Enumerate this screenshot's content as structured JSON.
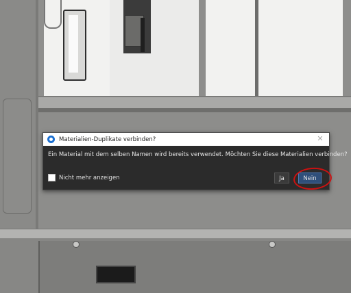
{
  "dialog": {
    "title": "Materialien-Duplikate verbinden?",
    "message": "Ein Material mit dem selben Namen wird bereits verwendet. Möchten Sie diese Materialien verbinden?",
    "checkbox_label": "Nicht mehr anzeigen",
    "checkbox_checked": false,
    "yes_label": "Ja",
    "no_label": "Nein",
    "close_icon": "close-icon",
    "app_icon": "app-logo-icon"
  },
  "colors": {
    "dialog_bg": "#2b2b2b",
    "titlebar_bg": "#ffffff",
    "accent": "#1a6fd1",
    "default_button": "#2f4f7a",
    "annotation": "#cc1111"
  }
}
